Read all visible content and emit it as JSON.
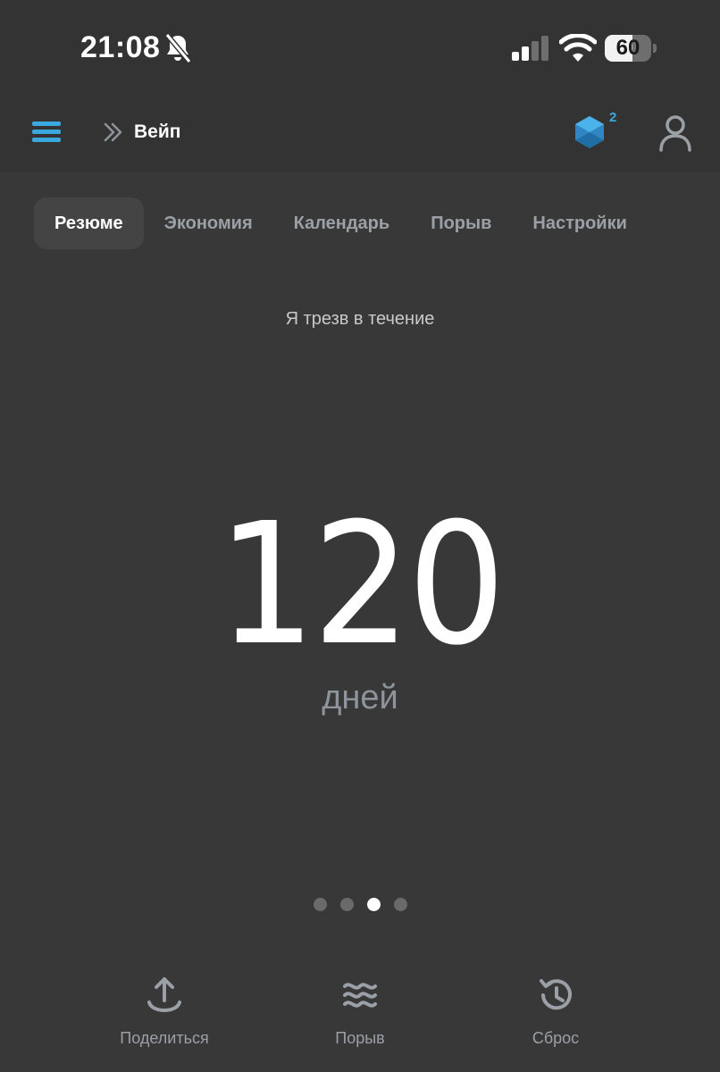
{
  "status_bar": {
    "time": "21:08",
    "battery_text": "60",
    "battery_level_percent": 60,
    "icons": [
      "bell-off-icon",
      "signal-icon",
      "wifi-icon",
      "battery-icon"
    ]
  },
  "header": {
    "app_title": "Вейп",
    "badge_count": "2",
    "icons": [
      "menu-icon",
      "chevrons-right-icon",
      "cube-icon",
      "user-icon"
    ]
  },
  "tabs": [
    {
      "label": "Резюме",
      "active": true
    },
    {
      "label": "Экономия",
      "active": false
    },
    {
      "label": "Календарь",
      "active": false
    },
    {
      "label": "Порыв",
      "active": false
    },
    {
      "label": "Настройки",
      "active": false
    }
  ],
  "counter": {
    "subtitle": "Я трезв в течение",
    "value": "120",
    "unit": "дней"
  },
  "pager": {
    "total": 4,
    "active_index": 2
  },
  "actions": [
    {
      "label": "Поделиться",
      "icon": "share-icon"
    },
    {
      "label": "Порыв",
      "icon": "waves-icon"
    },
    {
      "label": "Сброс",
      "icon": "history-icon"
    }
  ],
  "colors": {
    "background": "#383838",
    "header_background": "#333333",
    "accent": "#39a9e0",
    "muted_text": "#9aa0a6",
    "active_tab_bg": "#444444"
  }
}
